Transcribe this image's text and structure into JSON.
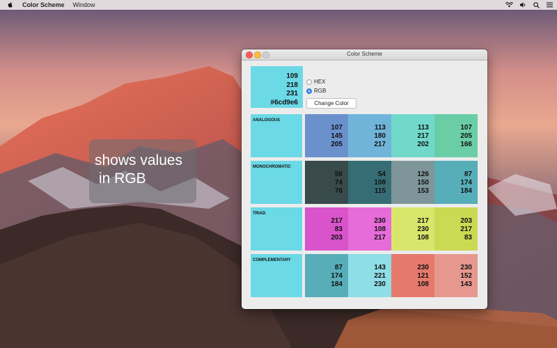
{
  "menubar": {
    "app_name": "Color Scheme",
    "menus": [
      "Window"
    ],
    "icons": [
      "apple-icon",
      "wifi-icon",
      "volume-icon",
      "search-icon",
      "list-icon"
    ]
  },
  "caption": {
    "line1": "shows values",
    "line2": "in RGB"
  },
  "window": {
    "title": "Color Scheme",
    "base_color": {
      "r": "109",
      "g": "218",
      "b": "231",
      "hex": "#6cd9e6",
      "swatch": "#6cd9e6"
    },
    "format_options": [
      {
        "label": "HEX",
        "selected": false
      },
      {
        "label": "RGB",
        "selected": true
      }
    ],
    "change_color_label": "Change Color",
    "schemes": [
      {
        "label": "ANALOGOUS",
        "colors": [
          {
            "swatch": "#6b91cd",
            "r": "107",
            "g": "145",
            "b": "205"
          },
          {
            "swatch": "#71b4d9",
            "r": "113",
            "g": "180",
            "b": "217"
          },
          {
            "swatch": "#71d9ca",
            "r": "113",
            "g": "217",
            "b": "202"
          },
          {
            "swatch": "#6bcda6",
            "r": "107",
            "g": "205",
            "b": "166"
          }
        ]
      },
      {
        "label": "MONOCHROMATIC",
        "colors": [
          {
            "swatch": "#384a4c",
            "r": "56",
            "g": "74",
            "b": "76"
          },
          {
            "swatch": "#366c73",
            "r": "54",
            "g": "108",
            "b": "115"
          },
          {
            "swatch": "#7e9699",
            "r": "126",
            "g": "150",
            "b": "153"
          },
          {
            "swatch": "#57aeb8",
            "r": "87",
            "g": "174",
            "b": "184"
          }
        ]
      },
      {
        "label": "TRIAD",
        "colors": [
          {
            "swatch": "#d953cb",
            "r": "217",
            "g": "83",
            "b": "203"
          },
          {
            "swatch": "#e66cd9",
            "r": "230",
            "g": "108",
            "b": "217"
          },
          {
            "swatch": "#d9e66c",
            "r": "217",
            "g": "230",
            "b": "108"
          },
          {
            "swatch": "#cbd953",
            "r": "203",
            "g": "217",
            "b": "83"
          }
        ]
      },
      {
        "label": "COMPLEMENTARY",
        "colors": [
          {
            "swatch": "#57aeb8",
            "r": "87",
            "g": "174",
            "b": "184"
          },
          {
            "swatch": "#8fdde6",
            "r": "143",
            "g": "221",
            "b": "230"
          },
          {
            "swatch": "#e6796c",
            "r": "230",
            "g": "121",
            "b": "108"
          },
          {
            "swatch": "#e6988f",
            "r": "230",
            "g": "152",
            "b": "143"
          }
        ]
      }
    ]
  }
}
